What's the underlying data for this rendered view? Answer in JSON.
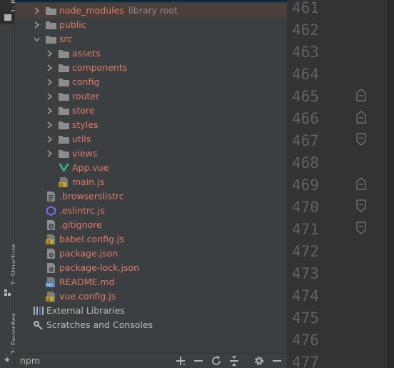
{
  "stripe": {
    "project_tab": "1: Project",
    "structure_tab": "7: Structure",
    "favorites_tab": "2: Favorites"
  },
  "tree": {
    "node_modules": {
      "label": "node_modules",
      "hint": "library root"
    },
    "public": "public",
    "src": "src",
    "src_children": [
      "assets",
      "components",
      "config",
      "router",
      "store",
      "styles",
      "utils",
      "views"
    ],
    "app_vue": "App.vue",
    "main_js": "main.js",
    "root_files": [
      ".browserslistrc",
      ".eslintrc.js",
      ".gitignore",
      "babel.config.js",
      "package.json",
      "package-lock.json",
      "README.md",
      "vue.config.js"
    ],
    "external_libraries": "External Libraries",
    "scratches": "Scratches and Consoles"
  },
  "bottombar": {
    "npm_label": "npm"
  },
  "gutter": {
    "line_numbers": [
      "461",
      "462",
      "463",
      "464",
      "465",
      "466",
      "467",
      "468",
      "469",
      "470",
      "471",
      "472",
      "473",
      "474",
      "475",
      "476",
      "477"
    ]
  },
  "icons": {
    "folder": "folder-icon",
    "vue": "vue-file-icon",
    "js": "js-file-icon",
    "config": "config-file-icon",
    "eslint": "eslint-icon",
    "gitignore": "gitignore-icon",
    "json": "json-file-icon",
    "markdown": "markdown-file-icon",
    "libraries": "libraries-icon",
    "scratches": "scratches-icon"
  },
  "colors": {
    "unversioned_text": "#e07a6a",
    "normal_text": "#bbbbbb",
    "folder": "#8c8c8c",
    "vue_green": "#41b883",
    "js_badge": "#c9a227"
  }
}
